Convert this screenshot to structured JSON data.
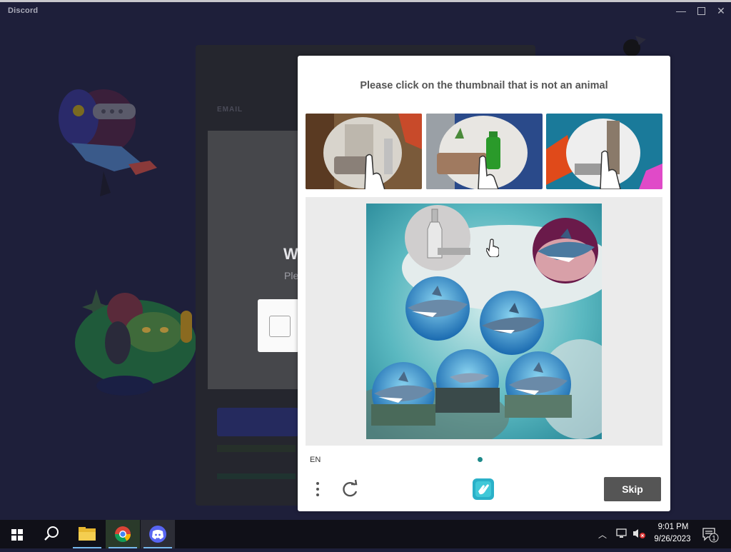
{
  "window": {
    "app_title": "Discord",
    "minimize_glyph": "—",
    "close_glyph": "✕"
  },
  "login": {
    "email_label": "EMAIL",
    "heading_partial": "W",
    "subtext_partial": "Ple"
  },
  "captcha": {
    "prompt": "Please click on the thumbnail that is not an animal",
    "thumbnails": [
      {
        "icon": "example-image-room-with-hand-cursor"
      },
      {
        "icon": "example-image-bottle-with-hand-cursor"
      },
      {
        "icon": "example-image-room-with-hand-cursor"
      }
    ],
    "challenge_items": [
      {
        "icon": "bottle-thumbnail",
        "is_animal": false
      },
      {
        "icon": "shark-thumbnail",
        "is_animal": true
      },
      {
        "icon": "shark-thumbnail",
        "is_animal": true
      },
      {
        "icon": "shark-thumbnail",
        "is_animal": true
      },
      {
        "icon": "shark-thumbnail",
        "is_animal": true
      },
      {
        "icon": "shark-thumbnail",
        "is_animal": true
      },
      {
        "icon": "shark-thumbnail",
        "is_animal": true
      }
    ],
    "language": "EN",
    "page_indicator": {
      "current": 1,
      "total": 1
    },
    "skip_label": "Skip",
    "colors": {
      "accent": "#1e8a8a",
      "skip_bg": "#555555",
      "prompt_text": "#555555"
    }
  },
  "taskbar": {
    "apps": [
      "start-icon",
      "search-icon",
      "file-explorer-icon",
      "chrome-icon",
      "discord-icon"
    ],
    "clock_time": "9:01 PM",
    "clock_date": "9/26/2023",
    "notification_count": "1"
  }
}
